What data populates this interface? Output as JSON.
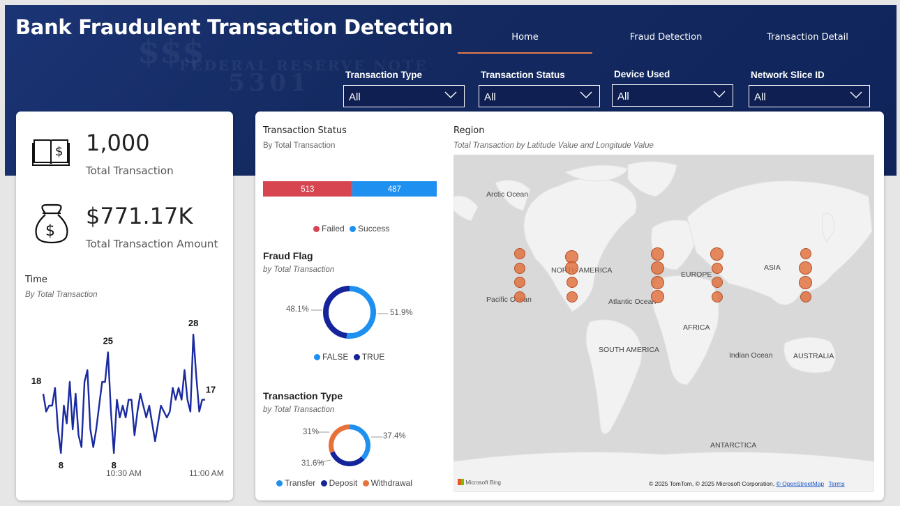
{
  "header": {
    "title": "Bank Fraudulent Transaction Detection",
    "nav": [
      {
        "label": "Home",
        "active": true
      },
      {
        "label": "Fraud Detection",
        "active": false
      },
      {
        "label": "Transaction Detail",
        "active": false
      }
    ],
    "watermark": [
      "FEDERAL RESERVE NOTE",
      "5301"
    ]
  },
  "filters": [
    {
      "label": "Transaction Type",
      "value": "All"
    },
    {
      "label": "Transaction Status",
      "value": "All"
    },
    {
      "label": "Device Used",
      "value": "All"
    },
    {
      "label": "Network Slice ID",
      "value": "All"
    }
  ],
  "kpis": {
    "total_transaction": {
      "value": "1,000",
      "label": "Total Transaction",
      "icon": "ledger-dollar-icon"
    },
    "total_amount": {
      "value": "$771.17K",
      "label": "Total Transaction Amount",
      "icon": "money-bag-icon"
    }
  },
  "time_chart": {
    "title": "Time",
    "subtitle": "By Total Transaction",
    "ticks": [
      "10:30 AM",
      "11:00 AM"
    ],
    "data_labels": [
      "18",
      "25",
      "8",
      "8",
      "28",
      "17"
    ]
  },
  "status_chart": {
    "title": "Transaction Status",
    "subtitle": "By Total Transaction",
    "legend": [
      "Failed",
      "Success"
    ]
  },
  "fraud_chart": {
    "title": "Fraud Flag",
    "subtitle": "by Total Transaction",
    "labels": [
      "48.1%",
      "51.9%"
    ],
    "legend": [
      "FALSE",
      "TRUE"
    ]
  },
  "type_chart": {
    "title": "Transaction Type",
    "subtitle": "by Total Transaction",
    "labels": [
      "31%",
      "31.6%",
      "37.4%"
    ],
    "legend": [
      "Transfer",
      "Deposit",
      "Withdrawal"
    ]
  },
  "region_map": {
    "title": "Region",
    "subtitle": "Total Transaction by Latitude Value and Longitude Value",
    "labels": [
      "Arctic Ocean",
      "NORTH AMERICA",
      "EUROPE",
      "ASIA",
      "Pacific Ocean",
      "Atlantic Ocean",
      "AFRICA",
      "SOUTH AMERICA",
      "Indian Ocean",
      "AUSTRALIA",
      "ANTARCTICA"
    ],
    "brand": "Microsoft Bing",
    "attribution": "© 2025 TomTom, © 2025 Microsoft Corporation,",
    "osm_link": "© OpenStreetMap",
    "terms_link": "Terms"
  },
  "colors": {
    "failed": "#d64550",
    "success": "#1e90f0",
    "true_navy": "#15249a",
    "withdrawal": "#e8703a",
    "line": "#1a2aa0",
    "bubble": "#e26f3c"
  },
  "chart_data": [
    {
      "type": "line",
      "title": "Time",
      "ylabel": "",
      "x_ticks": [
        "10:30 AM",
        "11:00 AM"
      ],
      "series": [
        {
          "values": [
            18,
            15,
            16,
            16,
            19,
            12,
            8,
            16,
            13,
            20,
            12,
            18,
            11,
            9,
            20,
            22,
            12,
            9,
            12,
            16,
            20,
            20,
            25,
            15,
            8,
            17,
            14,
            16,
            14,
            17,
            17,
            11,
            15,
            18,
            16,
            14,
            16,
            13,
            10,
            13,
            16,
            15,
            14,
            15,
            19,
            17,
            19,
            17,
            22,
            17,
            15,
            28,
            21,
            15,
            17,
            17
          ]
        }
      ],
      "point_labels": {
        "first": 18,
        "max_left": 25,
        "min_left": 8,
        "min_mid": 8,
        "max_right": 28,
        "last": 17
      }
    },
    {
      "type": "bar",
      "title": "Transaction Status",
      "orientation": "horizontal-stacked",
      "categories": [
        "Failed",
        "Success"
      ],
      "values": [
        513,
        487
      ]
    },
    {
      "type": "pie",
      "title": "Fraud Flag",
      "donut": true,
      "categories": [
        "FALSE",
        "TRUE"
      ],
      "values": [
        51.9,
        48.1
      ]
    },
    {
      "type": "pie",
      "title": "Transaction Type",
      "donut": true,
      "categories": [
        "Transfer",
        "Deposit",
        "Withdrawal"
      ],
      "values": [
        37.4,
        31.6,
        31
      ]
    },
    {
      "type": "scatter",
      "title": "Region",
      "x_label": "Longitude",
      "y_label": "Latitude",
      "points": [
        {
          "lon": -120,
          "lat": 47,
          "size": 1
        },
        {
          "lon": -120,
          "lat": 42,
          "size": 1
        },
        {
          "lon": -120,
          "lat": 37,
          "size": 1
        },
        {
          "lon": -120,
          "lat": 32,
          "size": 1
        },
        {
          "lon": -75,
          "lat": 46,
          "size": 1.2
        },
        {
          "lon": -75,
          "lat": 42,
          "size": 1.2
        },
        {
          "lon": -75,
          "lat": 37,
          "size": 1
        },
        {
          "lon": -75,
          "lat": 32,
          "size": 1
        },
        {
          "lon": -2,
          "lat": 47,
          "size": 1.2
        },
        {
          "lon": -2,
          "lat": 42,
          "size": 1.2
        },
        {
          "lon": -2,
          "lat": 37,
          "size": 1.2
        },
        {
          "lon": -2,
          "lat": 32,
          "size": 1.2
        },
        {
          "lon": 49,
          "lat": 47,
          "size": 1.2
        },
        {
          "lon": 49,
          "lat": 42,
          "size": 1
        },
        {
          "lon": 49,
          "lat": 37,
          "size": 1
        },
        {
          "lon": 49,
          "lat": 32,
          "size": 1
        },
        {
          "lon": 125,
          "lat": 47,
          "size": 1
        },
        {
          "lon": 125,
          "lat": 42,
          "size": 1.2
        },
        {
          "lon": 125,
          "lat": 37,
          "size": 1.2
        },
        {
          "lon": 125,
          "lat": 32,
          "size": 1
        }
      ]
    }
  ]
}
